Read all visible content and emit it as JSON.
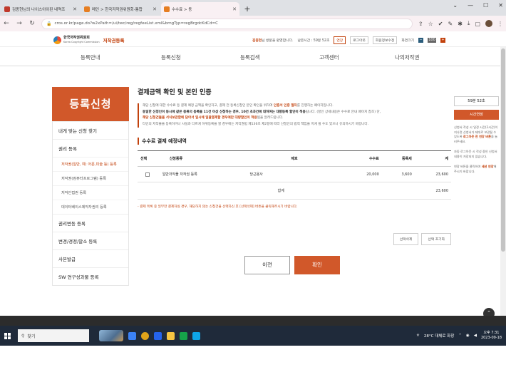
{
  "browser": {
    "tabs": [
      {
        "title": "김종현님의 나이스아이핀 내역조",
        "fav_color": "#c0392b",
        "active": false
      },
      {
        "title": "메인 > 한국저작권위원회-통합",
        "fav_color": "#e67e22",
        "active": false
      },
      {
        "title": "수수료 > 동",
        "fav_color": "#e67e22",
        "active": true
      }
    ],
    "new_tab": "+",
    "url": "cros.or.kr/page.do?w2xPath=/ui/twc/reg/regfeeList.xml&brngTyp=regBrgdcKdCd=C",
    "window_controls": [
      "⌄",
      "—",
      "☐",
      "✕"
    ]
  },
  "site": {
    "org_name_line1": "한국저작권위원회",
    "org_name_line2": "Korea Copyright Commission",
    "service_name": "저작권등록",
    "user_name": "김종현",
    "welcome": "님 방문을 환영합니다.",
    "session_label": "남은시간 : 59분 52초",
    "extend_label": "연장",
    "util_links": [
      "로그아웃",
      "회원정보수정",
      "화면크기"
    ],
    "zoom": {
      "minus": "−",
      "mid": "100",
      "plus": "+"
    }
  },
  "gnb": [
    "등록안내",
    "등록신청",
    "등록검색",
    "고객센터",
    "나의저작권"
  ],
  "lnb": {
    "title": "등록신청",
    "items": [
      {
        "label": "내게 맞는 신청 찾기",
        "type": "item"
      },
      {
        "label": "권리 등록",
        "type": "item"
      },
      {
        "label": "저작권(일반, 예: 어문,미술 등) 등록",
        "type": "sub",
        "active": true
      },
      {
        "label": "저작권(컴퓨터프로그램) 등록",
        "type": "sub"
      },
      {
        "label": "저작인접권 등록",
        "type": "sub"
      },
      {
        "label": "데이터베이스제작자권리 등록",
        "type": "sub"
      },
      {
        "label": "권리변동 등록",
        "type": "item"
      },
      {
        "label": "변경/경정/말소 등록",
        "type": "item"
      },
      {
        "label": "사본발급",
        "type": "item"
      },
      {
        "label": "SW 연구성과물 등록",
        "type": "item"
      }
    ]
  },
  "main": {
    "title": "결제금액 확인 및 본인 인증",
    "intro": {
      "line1_a": "해당 신청에 대한 수수료 등 결제 예정 금액을 확인하고, 결제 전 등록신청인 본인 확인을 위하여",
      "line1_b": "인증서 인증 절차",
      "line1_c": "를 진행하는 페이지입니다.",
      "line2_a": "동일한 신청인이 동시에 같은 종류의 등록을 11건 이상 신청하는 경우, 10건 초과건에 대하여는 대량등록 할인이 적용",
      "line2_b": "됩니다. (할인 상세내용은 수수료 안내 페이지 참조) 단,",
      "line3_a": "해당 신청건들을 서식보관함에 담아서 일시에 일괄결제할 경우에만 대량할인이 적용",
      "line3_b": "됨을 알려드립니다.",
      "line4": "타인의 저작물을 등록하거나 사실과 다르게 허위등록을 할 경우에는 저작권법 제136조 제2항에 따라 신청인의 법적 책임을 지게 될 수도 있으니 유의하시기 바랍니다."
    },
    "section_title": "수수료 결제 예정내역",
    "table": {
      "headers": [
        "선택",
        "신청종류",
        "제호",
        "수수료",
        "등록세",
        "계"
      ],
      "rows": [
        {
          "type": "일반저작물 저작권 등록",
          "title": "당근용사",
          "fee": "20,000",
          "tax": "3,600",
          "total": "23,600"
        }
      ],
      "sum_label": "합계",
      "sum_total": "23,600"
    },
    "note": "- 결제 목록 중 일부만 결제하실 경우, 해당하지 않는 신청건을 선택하신 후 [선택삭제] 버튼을 클릭해주시기 바랍니다.",
    "small_buttons": [
      "선택삭제",
      "선택 초기화"
    ],
    "prev_label": "이전",
    "next_label": "확인"
  },
  "right_widget": {
    "timer": "59분 52초",
    "extend": "시간연장",
    "text_a": "신청서 작성 시 일정 시간(2시간)이 지나면 신청서가 제대로 보관될 수 있도록",
    "text_red": "로그아웃 전 연장 버튼",
    "text_b": "을 눌러주세요.",
    "text2": "자동 로그아웃 시 작성 중인 신청서 내용이 저장되지 않습니다.",
    "text3_a": "연장 버튼을 클릭하여",
    "text3_red": "세션 연장",
    "text3_b": "해주시기 바랍니다."
  },
  "taskbar": {
    "search": "찾기",
    "weather": "28°C 대체로 화창",
    "time": "오후 7:31",
    "date": "2023-09-18"
  },
  "colors": {
    "accent": "#d1582a",
    "accent_text": "#c2410c",
    "taskbar": "#1f2a3a"
  }
}
